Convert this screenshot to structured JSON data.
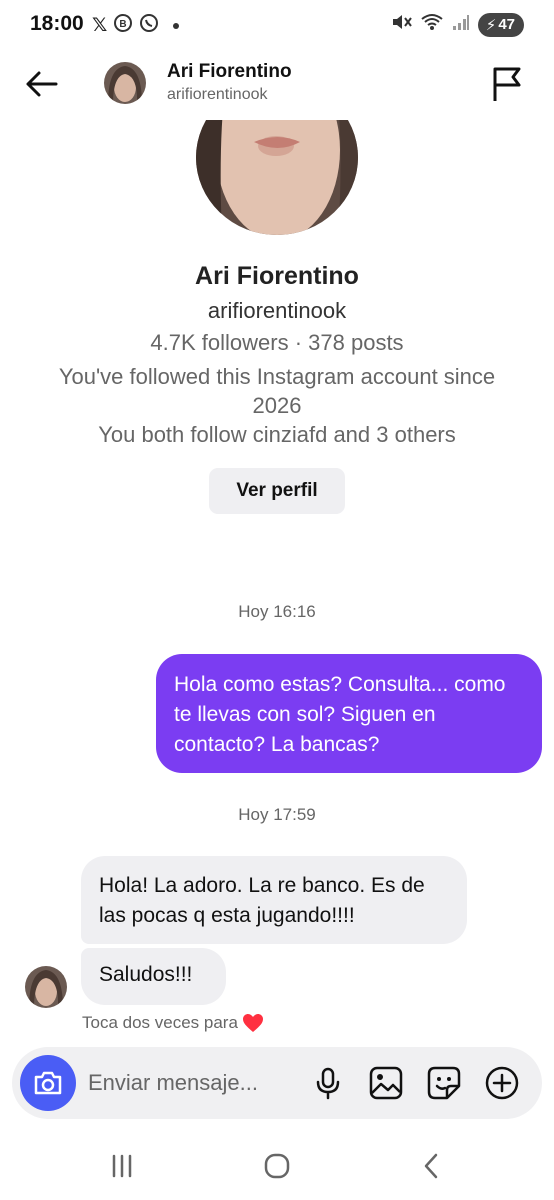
{
  "status_bar": {
    "time": "18:00",
    "left_icons": [
      "x-icon",
      "whatsapp-business-icon",
      "whatsapp-icon"
    ],
    "battery": "47"
  },
  "header": {
    "name": "Ari Fiorentino",
    "username": "arifiorentinook"
  },
  "profile": {
    "name": "Ari Fiorentino",
    "username": "arifiorentinook",
    "stats": "4.7K followers · 378 posts",
    "followed_since": "You've followed this Instagram account since 2026",
    "mutual": "You both follow cinziafd and 3 others",
    "view_profile_label": "Ver perfil"
  },
  "messages": [
    {
      "type": "timestamp",
      "text": "Hoy 16:16"
    },
    {
      "type": "outgoing",
      "text": "Hola como estas? Consulta... como te llevas con sol? Siguen en contacto? La bancas?"
    },
    {
      "type": "timestamp",
      "text": "Hoy 17:59"
    },
    {
      "type": "incoming",
      "text": "Hola! La adoro. La re banco. Es de las pocas q esta jugando!!!!"
    },
    {
      "type": "incoming",
      "text": "Saludos!!!"
    }
  ],
  "hint": {
    "text": "Toca dos veces para",
    "icon": "heart-icon",
    "icon_color": "#ff3040"
  },
  "composer": {
    "placeholder": "Enviar mensaje...",
    "camera_color": "#4a5df5"
  },
  "colors": {
    "outgoing_bubble": "#7b3df2",
    "incoming_bubble": "#efeff2"
  }
}
